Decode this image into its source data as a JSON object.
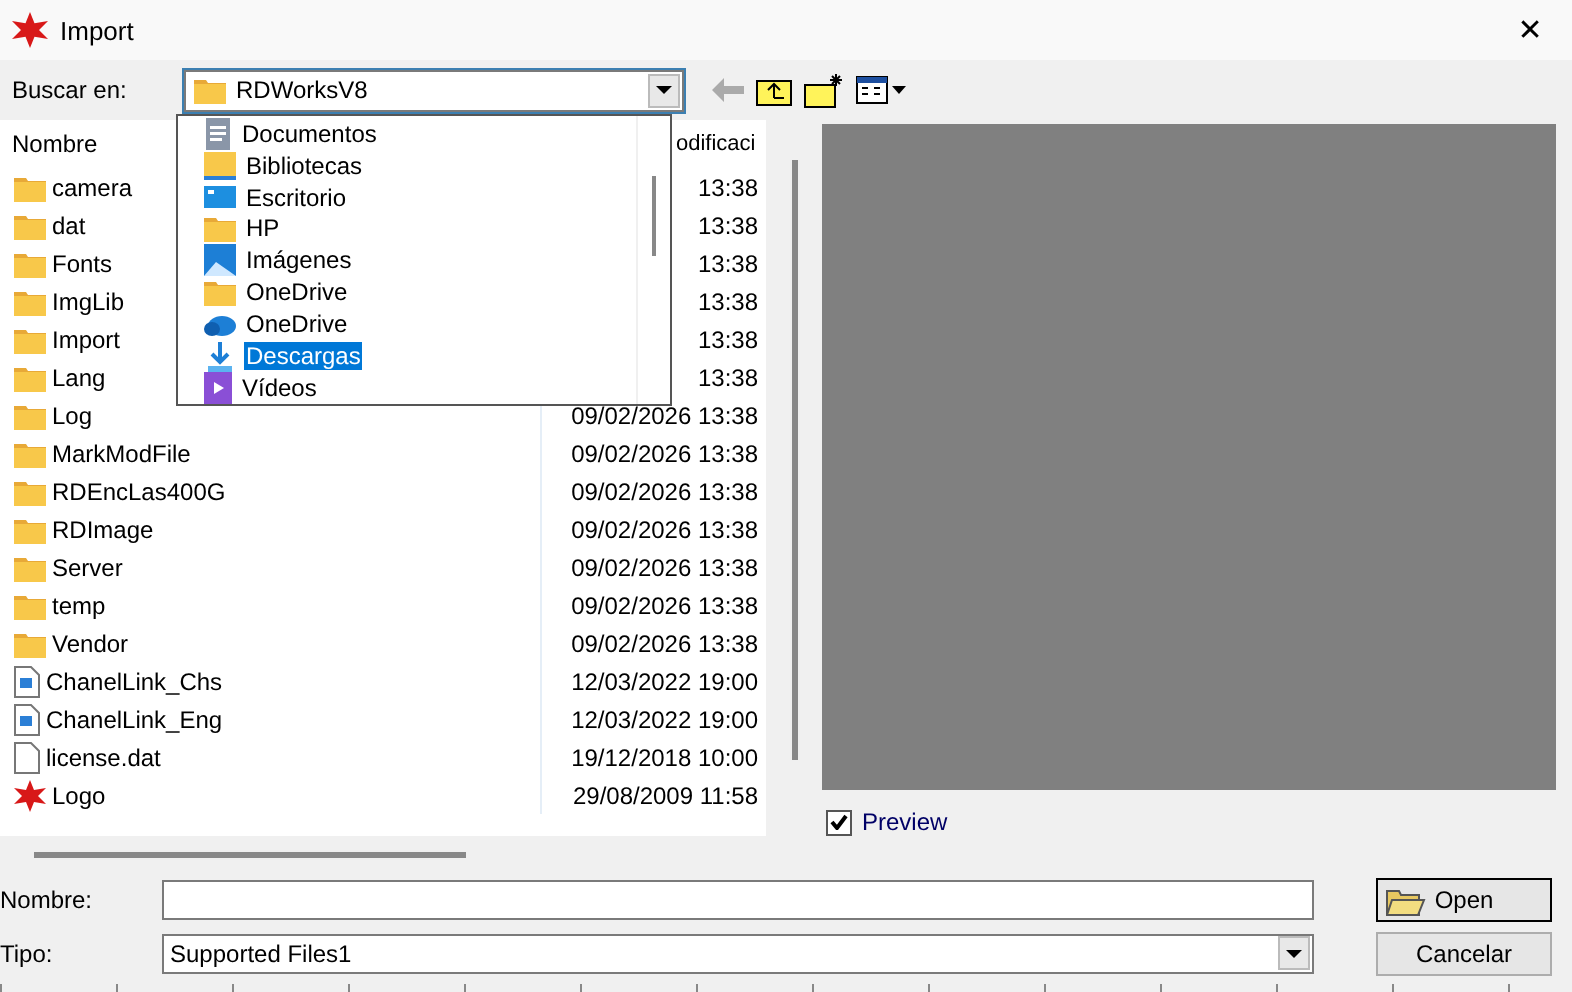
{
  "window": {
    "title": "Import",
    "close": "✕"
  },
  "location": {
    "label": "Buscar en:",
    "value": "RDWorksV8",
    "expanded": true
  },
  "dropdown": [
    {
      "label": "Documentos",
      "kind": "documents",
      "selected": false
    },
    {
      "label": "Bibliotecas",
      "kind": "library",
      "selected": false
    },
    {
      "label": "Escritorio",
      "kind": "desktop",
      "selected": false
    },
    {
      "label": "HP",
      "kind": "folder",
      "selected": false
    },
    {
      "label": "Imágenes",
      "kind": "pictures",
      "selected": false
    },
    {
      "label": "OneDrive",
      "kind": "folder",
      "selected": false
    },
    {
      "label": "OneDrive",
      "kind": "cloud",
      "selected": false
    },
    {
      "label": "Descargas",
      "kind": "download",
      "selected": true
    },
    {
      "label": "Vídeos",
      "kind": "video",
      "selected": false
    }
  ],
  "file_list": {
    "columns": [
      "Nombre",
      "odificaci"
    ],
    "rows": [
      {
        "name": "camera",
        "date": "13:38",
        "kind": "folder"
      },
      {
        "name": "dat",
        "date": "13:38",
        "kind": "folder"
      },
      {
        "name": "Fonts",
        "date": "13:38",
        "kind": "folder"
      },
      {
        "name": "ImgLib",
        "date": "13:38",
        "kind": "folder"
      },
      {
        "name": "Import",
        "date": "13:38",
        "kind": "folder"
      },
      {
        "name": "Lang",
        "date": "13:38",
        "kind": "folder"
      },
      {
        "name": "Log",
        "date": "09/02/2026 13:38",
        "kind": "folder"
      },
      {
        "name": "MarkModFile",
        "date": "09/02/2026 13:38",
        "kind": "folder"
      },
      {
        "name": "RDEncLas400G",
        "date": "09/02/2026 13:38",
        "kind": "folder"
      },
      {
        "name": "RDImage",
        "date": "09/02/2026 13:38",
        "kind": "folder"
      },
      {
        "name": "Server",
        "date": "09/02/2026 13:38",
        "kind": "folder"
      },
      {
        "name": "temp",
        "date": "09/02/2026 13:38",
        "kind": "folder"
      },
      {
        "name": "Vendor",
        "date": "09/02/2026 13:38",
        "kind": "folder"
      },
      {
        "name": "ChanelLink_Chs",
        "date": "12/03/2022 19:00",
        "kind": "image-file"
      },
      {
        "name": "ChanelLink_Eng",
        "date": "12/03/2022 19:00",
        "kind": "image-file"
      },
      {
        "name": "license.dat",
        "date": "19/12/2018 10:00",
        "kind": "file"
      },
      {
        "name": "Logo",
        "date": "29/08/2009 11:58",
        "kind": "logo"
      }
    ]
  },
  "preview": {
    "label": "Preview",
    "checked": true
  },
  "name_field": {
    "label": "Nombre:"
  },
  "type_field": {
    "label": "Tipo:",
    "value": "Supported Files1"
  },
  "buttons": {
    "open": "Open",
    "cancel": "Cancelar"
  }
}
